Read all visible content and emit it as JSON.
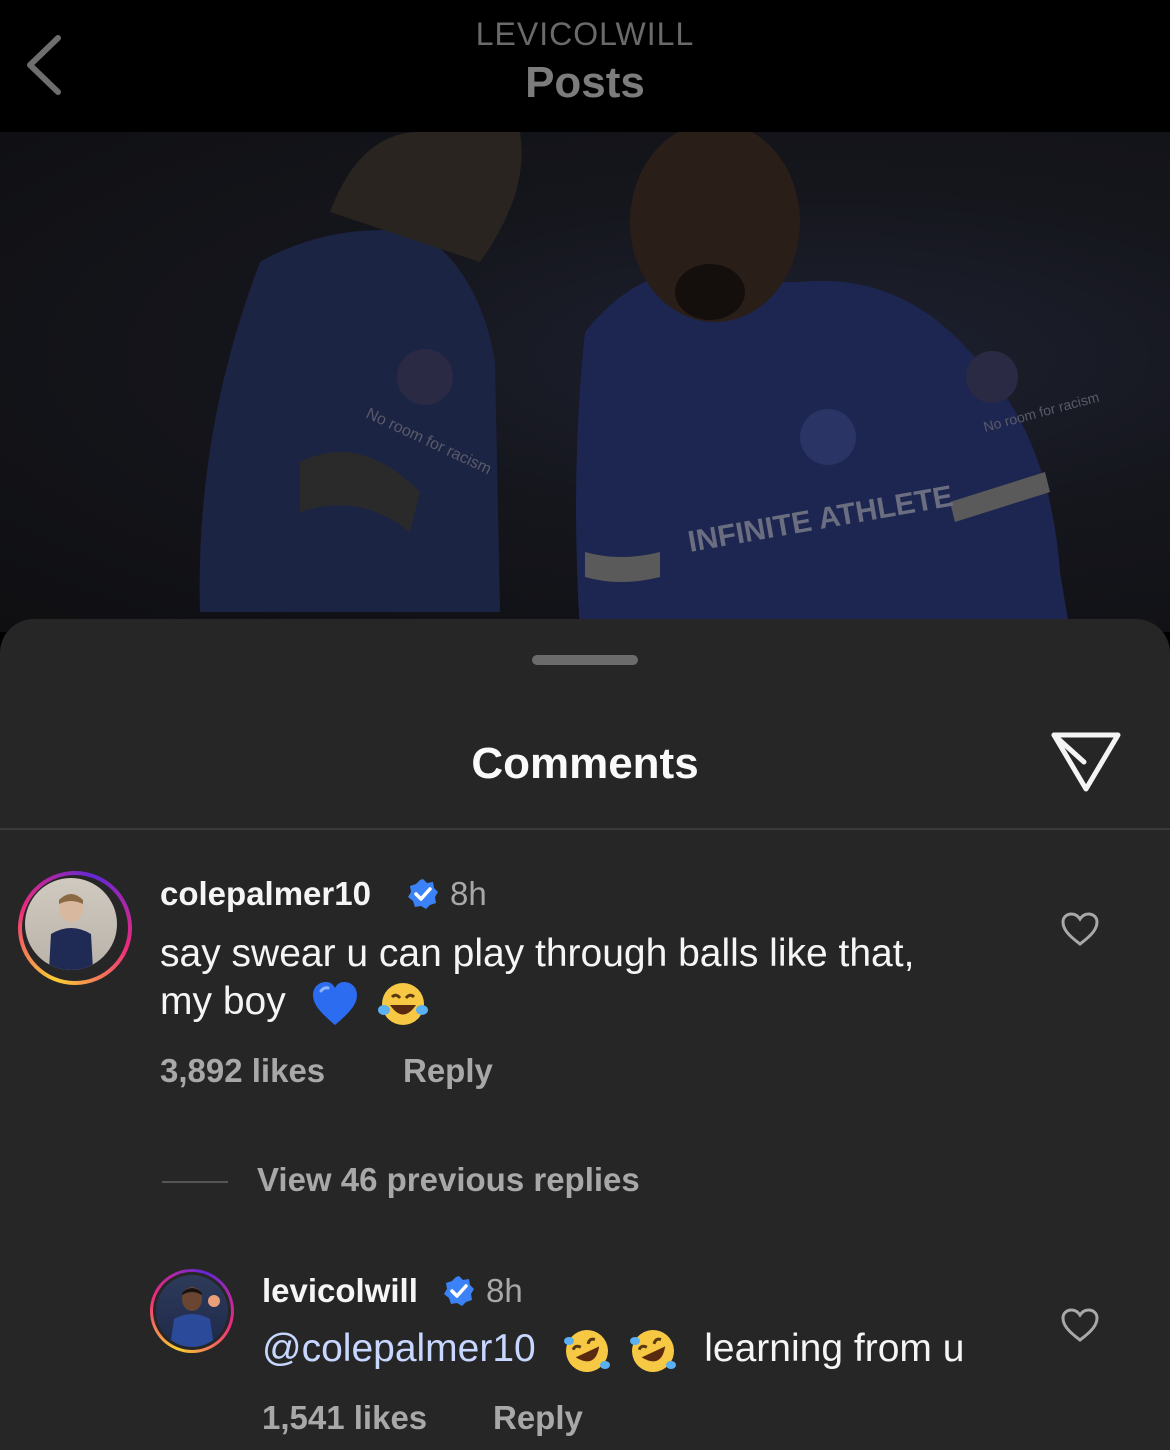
{
  "header": {
    "username": "LEVICOLWILL",
    "title": "Posts"
  },
  "photo": {
    "sponsor_text": "INFINITE ATHLETE",
    "sleeve_text_left": "No room for racism",
    "sleeve_text_right": "No room for racism"
  },
  "sheet": {
    "title": "Comments"
  },
  "comments": [
    {
      "username": "colepalmer10",
      "time": "8h",
      "text_line1": "say swear u can play through balls like that,",
      "text_line2": "my boy",
      "likes": "3,892 likes",
      "reply_label": "Reply"
    }
  ],
  "view_previous": "View 46 previous replies",
  "replies": [
    {
      "username": "levicolwill",
      "time": "8h",
      "mention": "@colepalmer10",
      "text": "learning from u",
      "likes": "1,541 likes",
      "reply_label": "Reply"
    }
  ],
  "colors": {
    "sheet_bg": "#262626",
    "verified_blue": "#3b82f6",
    "muted_text": "#a8a8a8"
  }
}
